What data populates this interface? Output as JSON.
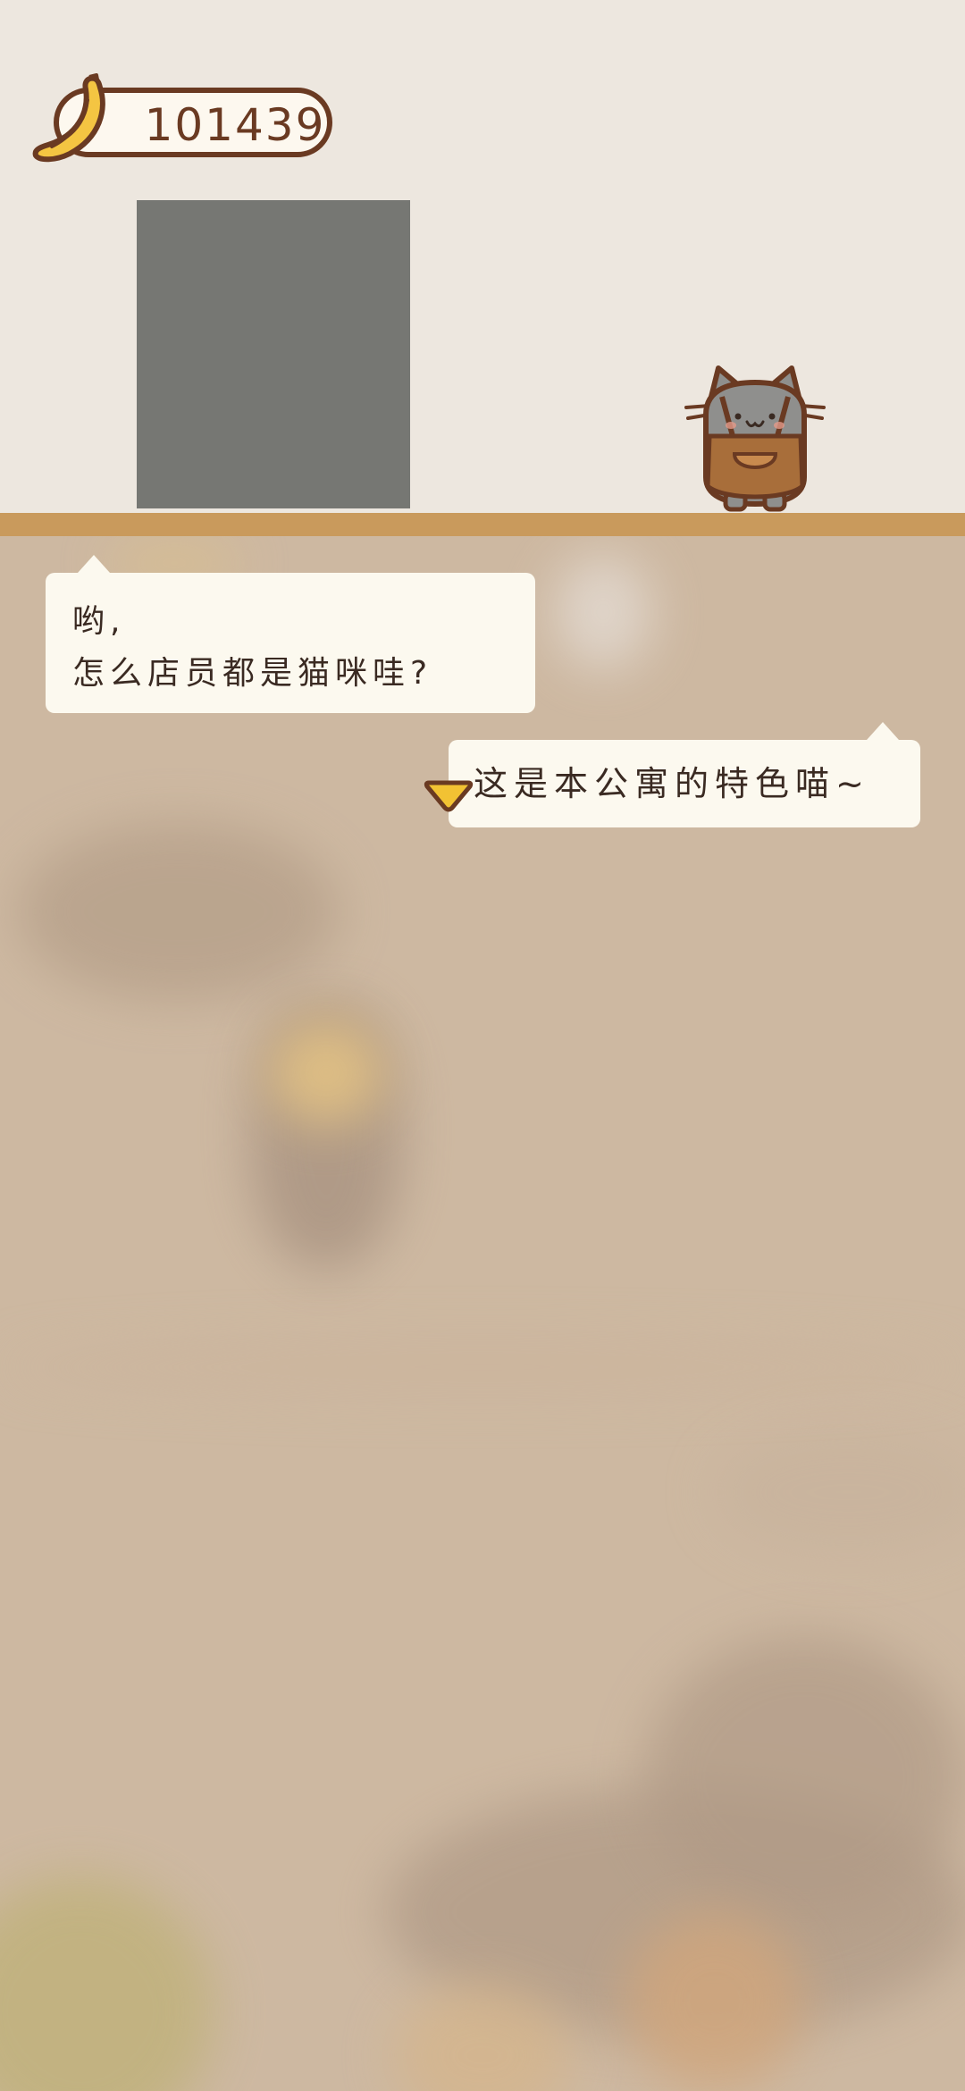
{
  "hud": {
    "currency_icon": "banana-icon",
    "currency_value": "101439"
  },
  "npc": {
    "icon": "cat-shopkeeper-icon"
  },
  "dialog": {
    "line_1": "哟,",
    "line_2": "怎么店员都是猫咪哇?",
    "reply": "这是本公寓的特色喵~",
    "continue_icon": "triangle-down-icon"
  },
  "colors": {
    "outline_brown": "#6a3a22",
    "floor": "#c99a5c",
    "bubble": "#fcf9ef",
    "banana": "#f4c542",
    "cat_grey": "#8f8f8d",
    "apron": "#a86e3a"
  }
}
